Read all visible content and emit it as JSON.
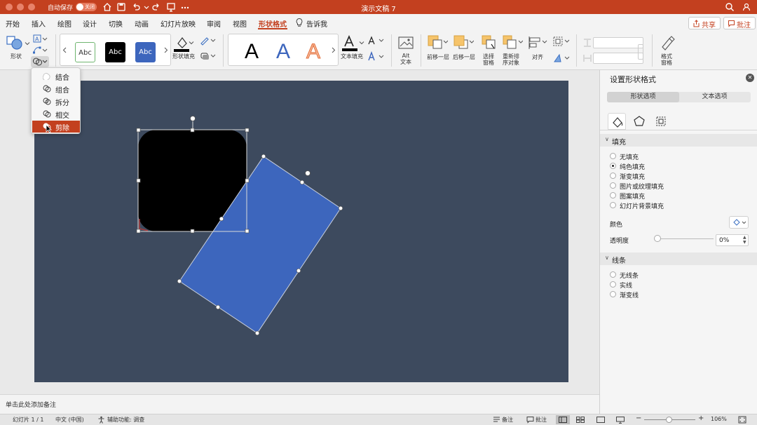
{
  "titlebar": {
    "autosave_label": "自动保存",
    "autosave_state": "关闭",
    "doc_title": "演示文稿 7"
  },
  "menu": {
    "tabs": [
      "开始",
      "插入",
      "绘图",
      "设计",
      "切换",
      "动画",
      "幻灯片放映",
      "审阅",
      "视图",
      "形状格式"
    ],
    "active_tab": "形状格式",
    "tell_me": "告诉我",
    "share_label": "共享",
    "comment_label": "批注"
  },
  "ribbon": {
    "shape_label": "形状",
    "style_samples": [
      "Abc",
      "Abc",
      "Abc"
    ],
    "shape_fill_label": "形状填充",
    "wordart_samples": [
      "A",
      "A",
      "A"
    ],
    "text_fill_label": "文本填充",
    "alt_text_label": "Alt\n文本",
    "bring_forward_label": "前移一层",
    "send_backward_label": "后移一层",
    "selection_pane_label": "选择\n窗格",
    "reorder_label": "重新排\n序对象",
    "align_label": "对齐",
    "format_pane_label": "格式\n窗格"
  },
  "merge_menu": {
    "items": [
      "结合",
      "组合",
      "拆分",
      "相交",
      "剪除"
    ],
    "selected": "剪除"
  },
  "notes": {
    "placeholder": "单击此处添加备注"
  },
  "status": {
    "slide_info": "幻灯片 1 / 1",
    "language": "中文 (中国)",
    "accessibility": "辅助功能: 调查",
    "notes_btn": "备注",
    "comments_btn": "批注",
    "zoom": "106%"
  },
  "pane": {
    "title": "设置形状格式",
    "tabs": [
      "形状选项",
      "文本选项"
    ],
    "active_tab": "形状选项",
    "fill_section": "填充",
    "fill_options": [
      "无填充",
      "纯色填充",
      "渐变填充",
      "图片或纹理填充",
      "图案填充",
      "幻灯片背景填充"
    ],
    "fill_selected": "纯色填充",
    "color_label": "颜色",
    "transparency_label": "透明度",
    "transparency_value": "0%",
    "line_section": "线条",
    "line_options": [
      "无线条",
      "实线",
      "渐变线"
    ]
  },
  "colors": {
    "accent": "#c3401f",
    "slide_bg": "#3d4a5e",
    "blue_shape": "#3d66bd",
    "black_shape": "#000000"
  }
}
